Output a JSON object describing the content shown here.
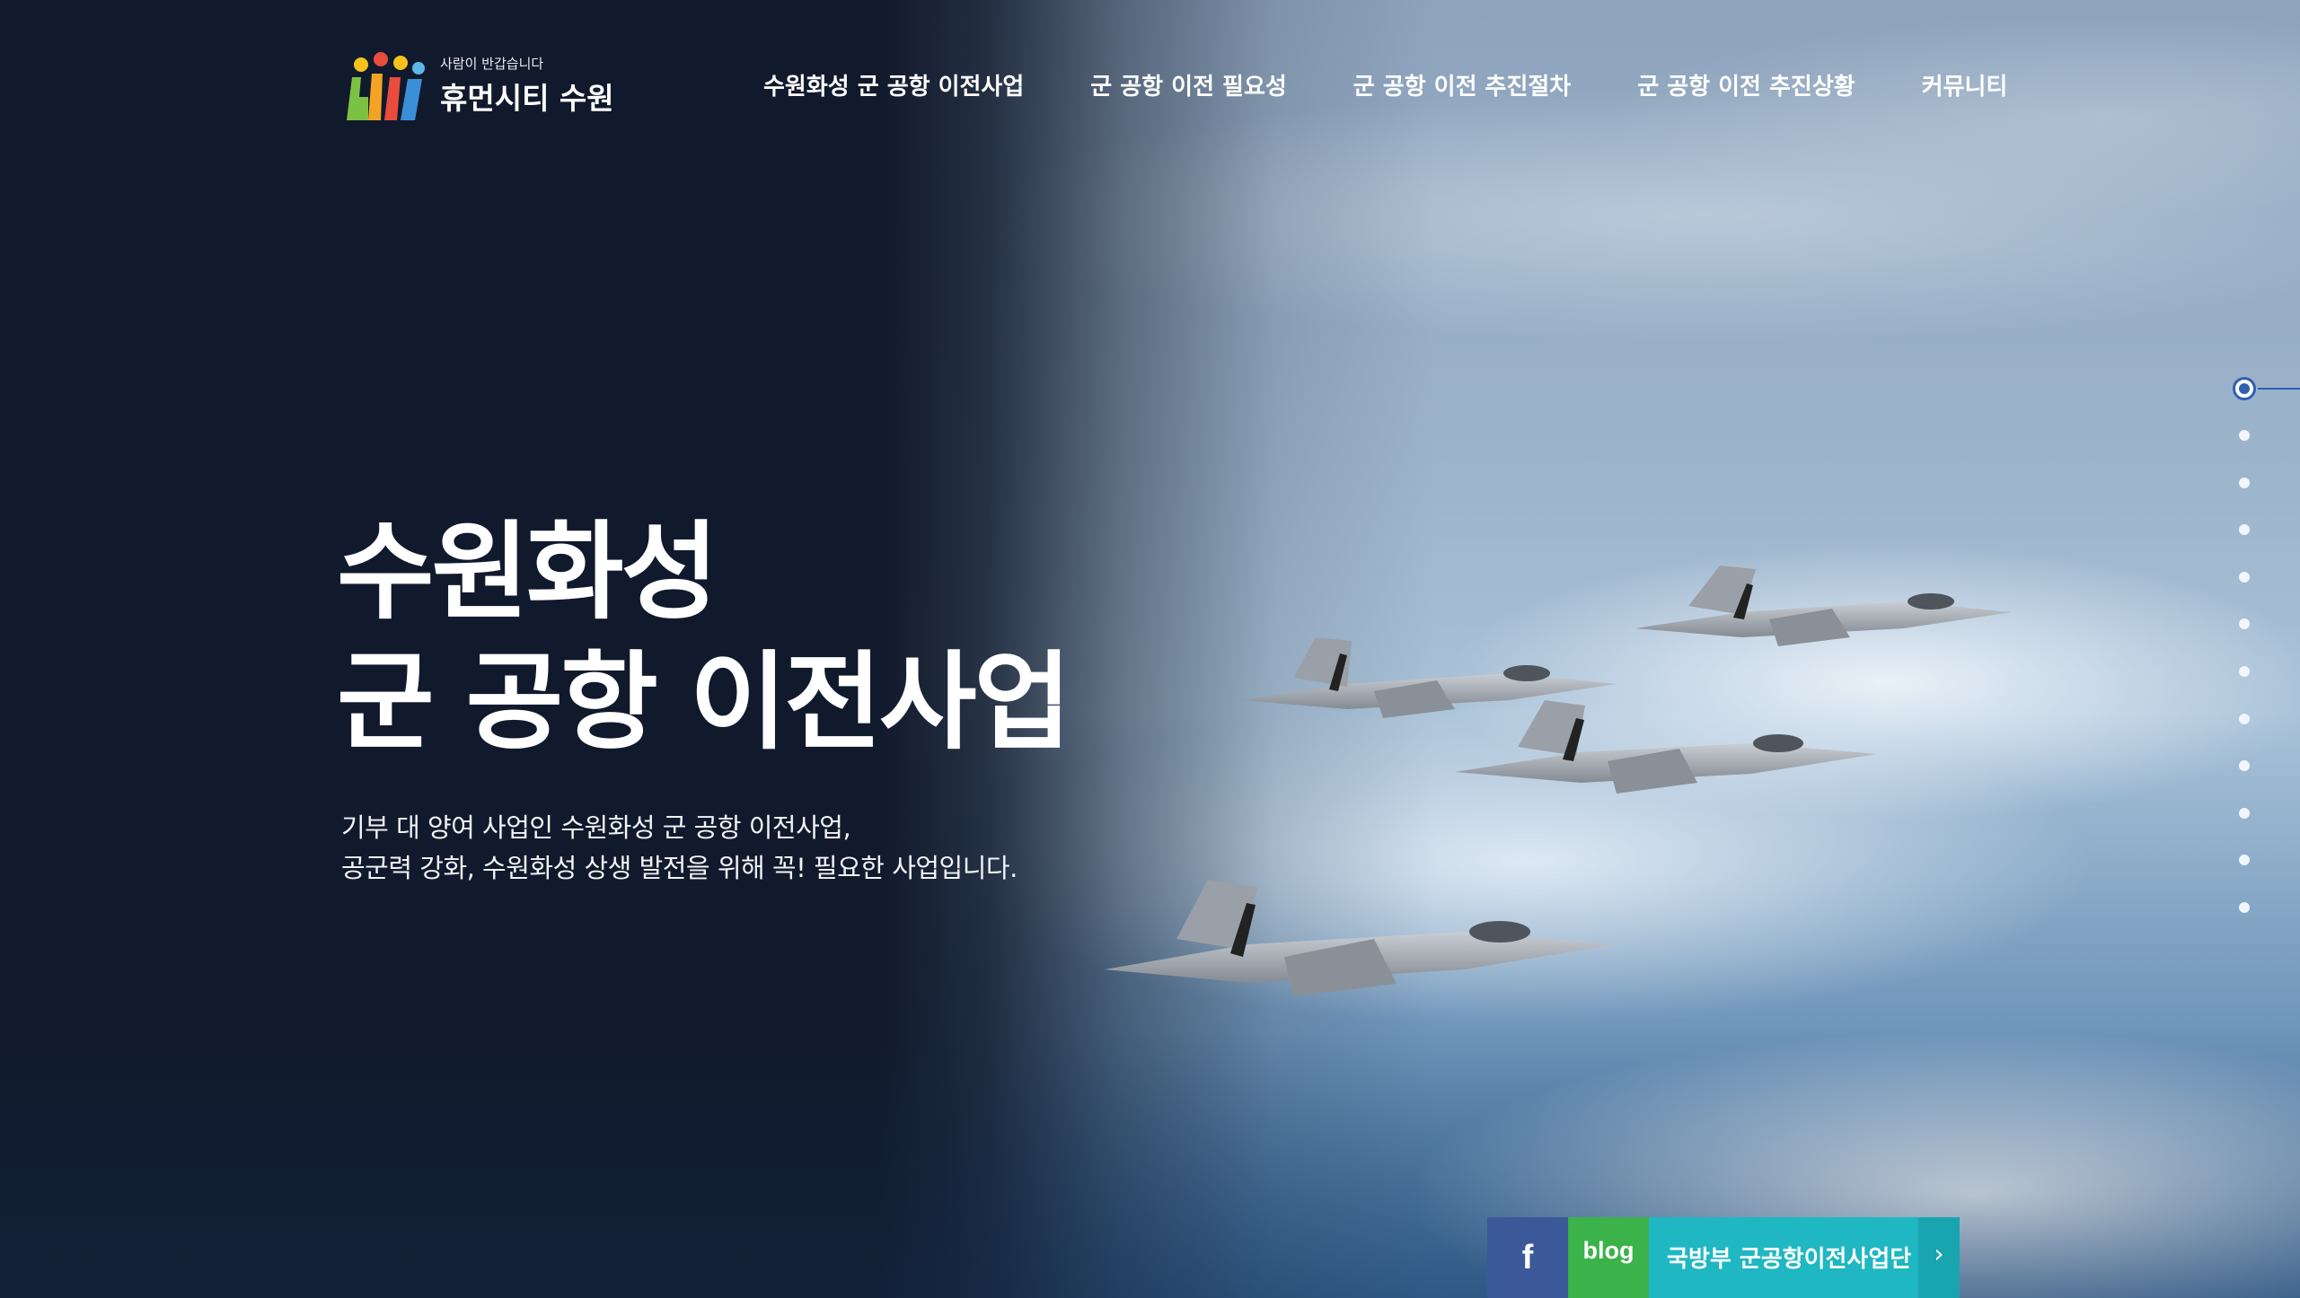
{
  "header": {
    "logo": {
      "tagline": "사람이 반갑습니다",
      "name": "휴먼시티 수원"
    },
    "nav": [
      {
        "label": "수원화성 군 공항 이전사업"
      },
      {
        "label": "군 공항 이전 필요성"
      },
      {
        "label": "군 공항 이전 추진절차"
      },
      {
        "label": "군 공항 이전 추진상황"
      },
      {
        "label": "커뮤니티"
      }
    ]
  },
  "hero": {
    "title_line1": "수원화성",
    "title_line2": "군 공항 이전사업",
    "desc_line1": "기부 대 양여 사업인 수원화성 군 공항 이전사업,",
    "desc_line2": "공군력 강화, 수원화성 상생 발전을 위해 꼭! 필요한 사업입니다."
  },
  "pager": {
    "count": 12,
    "active_index": 0
  },
  "quick_links": {
    "facebook": {
      "label": "f",
      "icon": "facebook-icon",
      "color": "#3b5998"
    },
    "blog": {
      "label": "blog",
      "color": "#3cb24a"
    },
    "mnd": {
      "label": "국방부 군공항이전사업단",
      "arrow": "›",
      "color": "#1fb7c2"
    }
  },
  "colors": {
    "dark_navy": "#111a2c",
    "accent_blue": "#2f5fb0"
  }
}
